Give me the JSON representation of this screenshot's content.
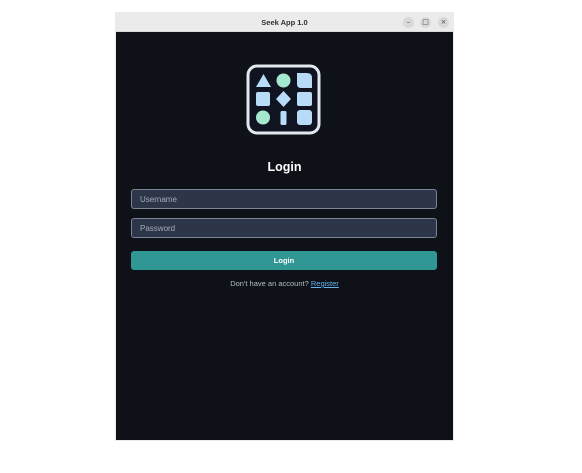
{
  "window": {
    "title": "Seek App 1.0",
    "minimize_glyph": "–",
    "maximize_glyph": "□",
    "close_glyph": "×"
  },
  "logo": {
    "icon": "app-logo-shapes-grid-icon",
    "colors": {
      "frame": "#e2e8f0",
      "blue": "#b8dcf8",
      "mint": "#a4e8d0"
    }
  },
  "login_form": {
    "heading": "Login",
    "username_placeholder": "Username",
    "username_value": "",
    "password_placeholder": "Password",
    "password_value": "",
    "submit_label": "Login",
    "register_prompt": "Don't have an account?",
    "register_link": "Register"
  },
  "colors": {
    "background": "#0e1118",
    "input_bg": "#2d3648",
    "accent": "#319795",
    "link": "#63b3ed"
  }
}
